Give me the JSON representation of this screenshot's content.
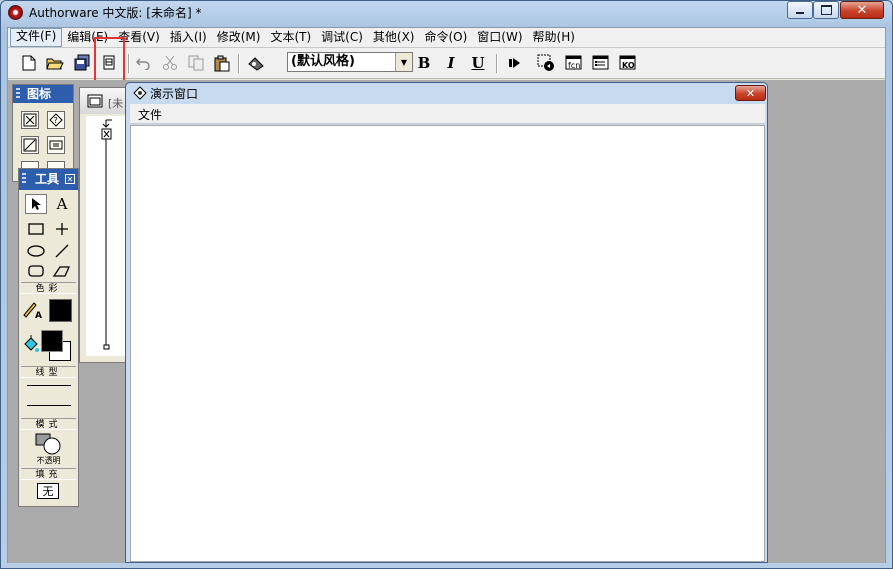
{
  "window": {
    "title": "Authorware 中文版: [未命名] *",
    "controls": {
      "minimize": "minimize",
      "maximize": "maximize",
      "close": "✕"
    }
  },
  "menubar": {
    "items": [
      "文件(F)",
      "编辑(E)",
      "查看(V)",
      "插入(I)",
      "修改(M)",
      "文本(T)",
      "调试(C)",
      "其他(X)",
      "命令(O)",
      "窗口(W)",
      "帮助(H)"
    ]
  },
  "toolbar": {
    "style_combo_value": "(默认风格)",
    "bold_label": "B",
    "italic_label": "I",
    "underline_label": "U",
    "icon_names": [
      "new-file-icon",
      "open-file-icon",
      "save-all-icon",
      "import-icon",
      "undo-icon",
      "cut-icon",
      "copy-icon",
      "paste-icon",
      "find-icon",
      "run-icon",
      "control-panel-icon",
      "functions-icon",
      "variables-icon",
      "knowledge-objects-icon"
    ],
    "fn_label": "fcn",
    "ko_label": "KO"
  },
  "icons_panel": {
    "title": "图标"
  },
  "flow_window": {
    "title": "[未"
  },
  "tools_panel": {
    "title": "工具",
    "color_label": "色彩",
    "line_label": "线型",
    "mode_label": "模式",
    "mode_value": "不透明",
    "fill_label": "填充",
    "fill_value": "无"
  },
  "presentation_window": {
    "title": "演示窗口",
    "menu_file": "文件"
  },
  "colors": {
    "titlebar_blue": "#2d5eae",
    "highlight": "#e53434",
    "close_red": "#c9442b"
  }
}
